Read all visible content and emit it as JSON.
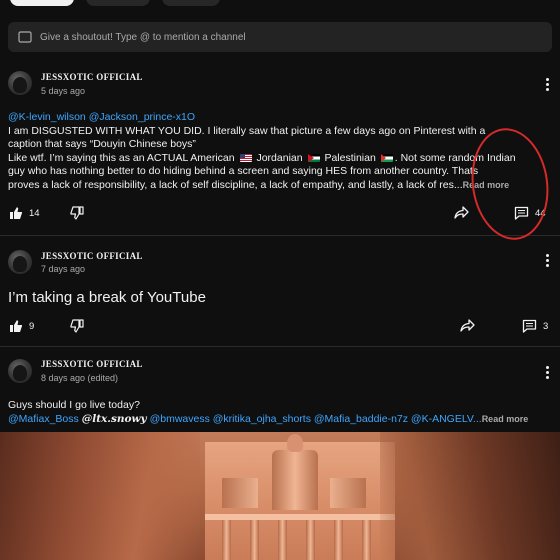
{
  "shoutout": {
    "placeholder": "Give a shoutout! Type @ to mention a channel"
  },
  "posts": [
    {
      "author": "JESSXOTIC OFFICIAL",
      "time": "5 days ago",
      "mentions": "@K-levin_wilson @Jackson_prince-x1O",
      "line1": "I am DISGUSTED WITH WHAT YOU DID. I literally saw that picture a few days ago on Pinterest with a",
      "line2": "caption that says “Douyin Chinese boys”",
      "line3_a": "Like wtf. I’m saying this as an ACTUAL American",
      "line3_b": "Jordanian",
      "line3_c": "Palestinian",
      "line3_d": ". Not some random Indian",
      "line4": "guy who has nothing better to do hiding behind a screen and saying HES from another country. Thats",
      "line5": "proves a lack of responsibility, a lack of self discipline, a lack of empathy, and lastly, a lack of res...",
      "read_more": "Read more",
      "likes": "14",
      "comments": "44"
    },
    {
      "author": "JESSXOTIC OFFICIAL",
      "time": "7 days ago",
      "text": "I’m taking a break of YouTube",
      "likes": "9",
      "comments": "3"
    },
    {
      "author": "JESSXOTIC OFFICIAL",
      "time": "8 days ago (edited)",
      "text": "Guys should I go live today?",
      "m1": "@Mafiax_Boss",
      "m2": "@𝒍𝒕𝒙.𝒔𝒏𝒐𝒘𝒚",
      "m3": "@bmwavess @kritika_ojha_shorts @Mafia_baddie-n7z @K-ANGELV...",
      "read_more": "Read more"
    }
  ],
  "colors": {
    "background": "#0f0f0f",
    "mention": "#3ea6ff",
    "annotation": "#d42a2a"
  }
}
